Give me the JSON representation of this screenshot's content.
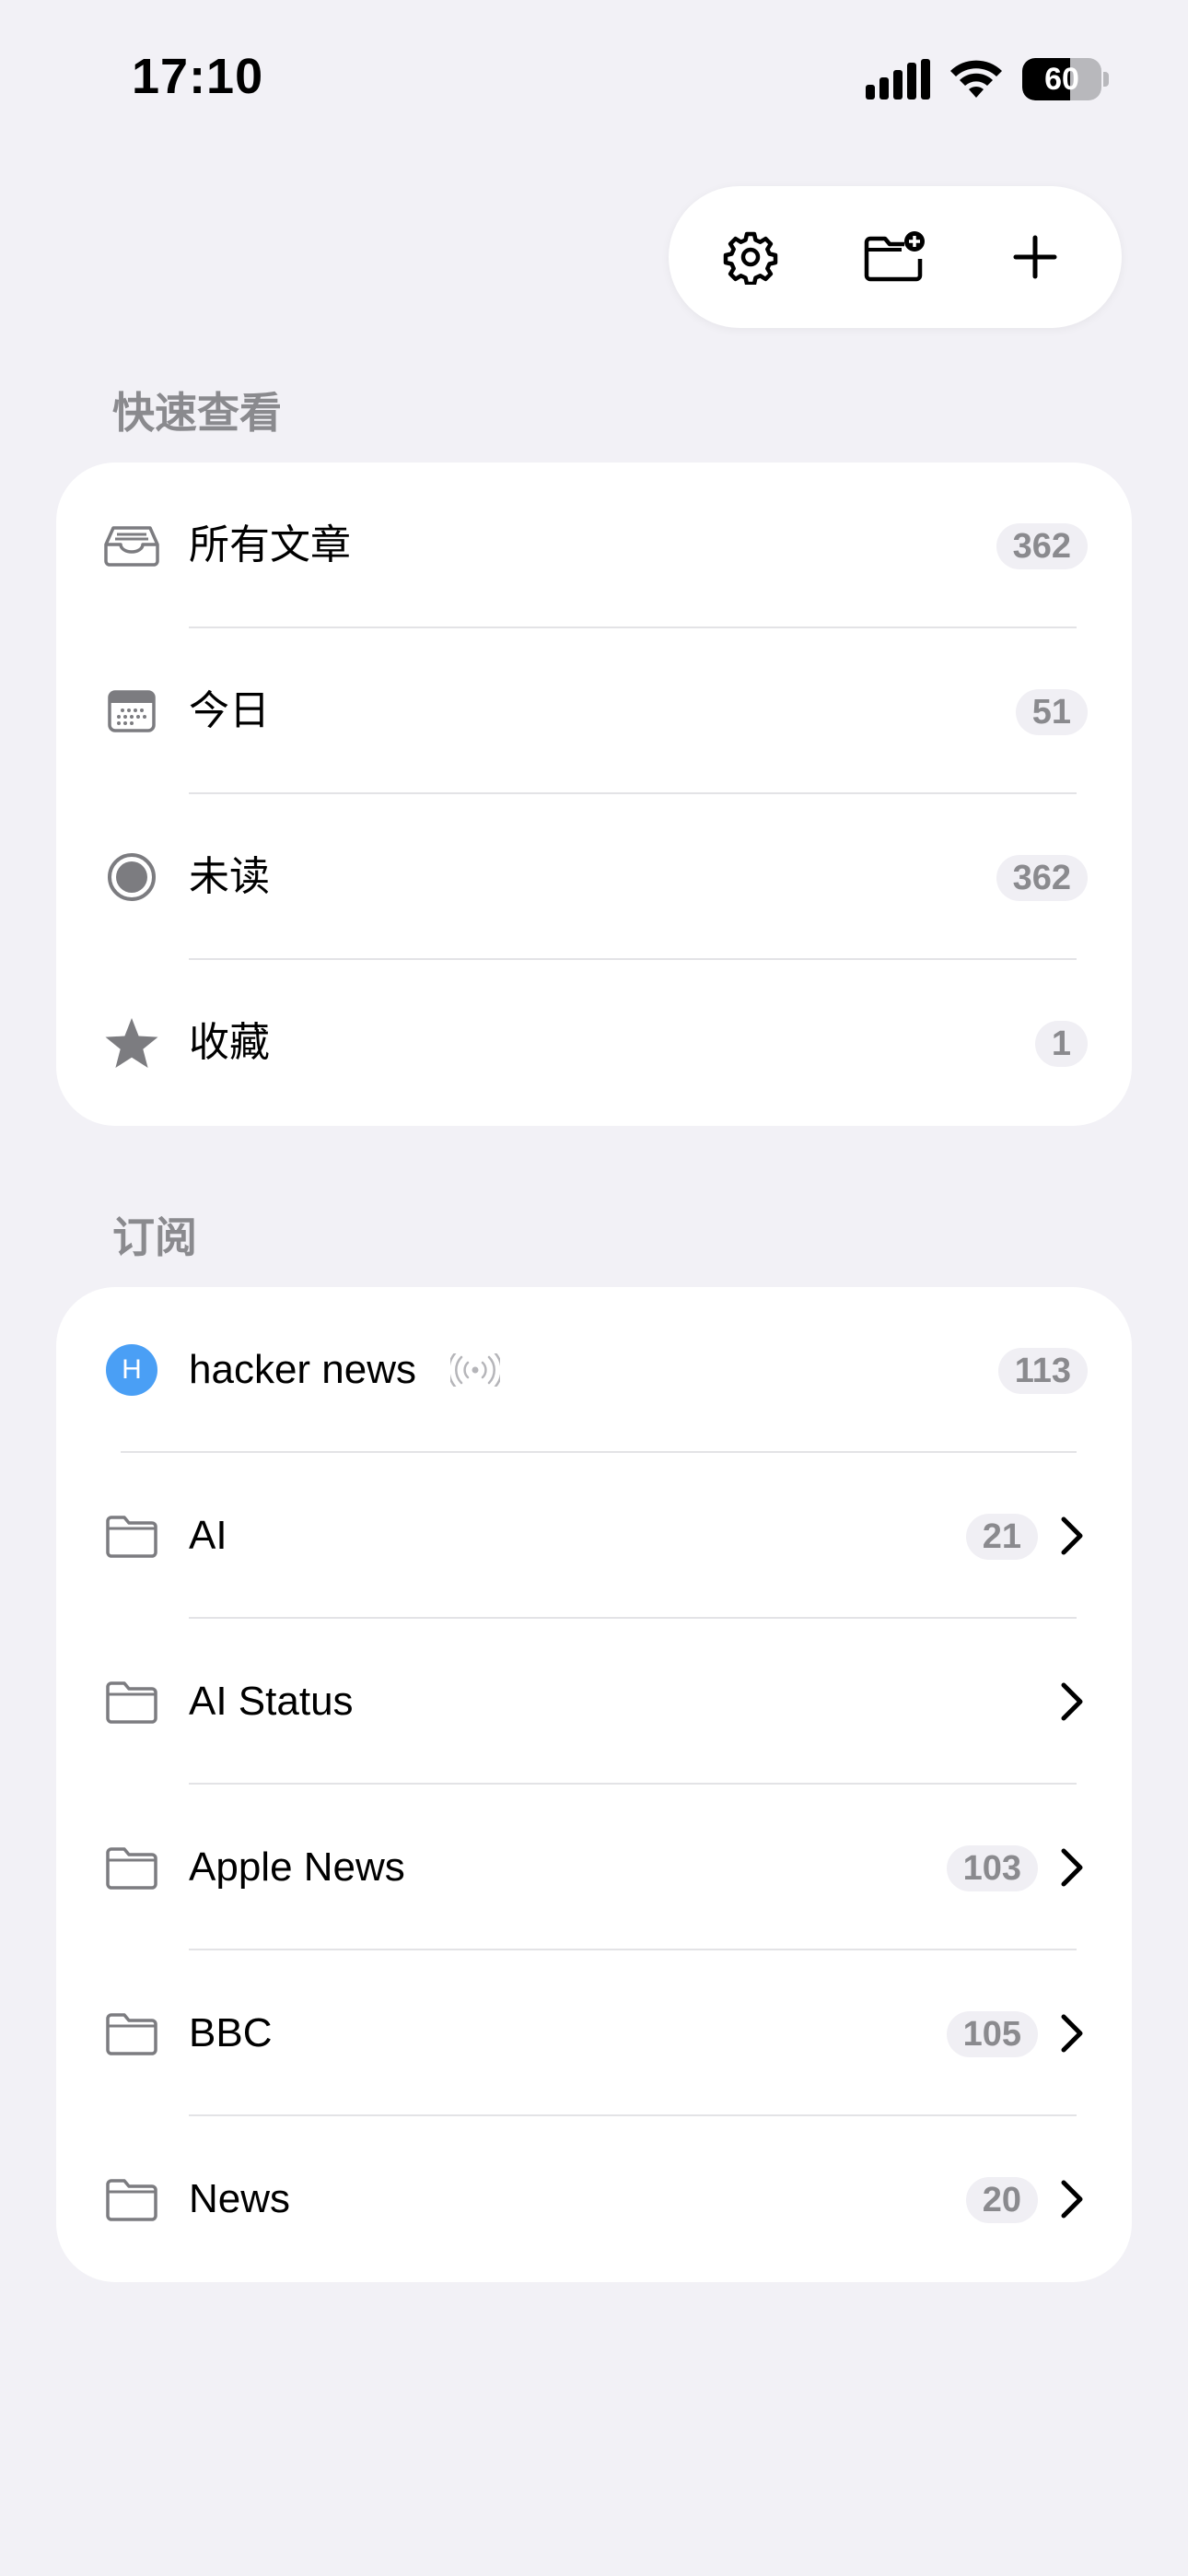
{
  "status_bar": {
    "time": "17:10",
    "battery": "60",
    "battery_level": 0.6
  },
  "toolbar": {
    "settings_icon": "gear-icon",
    "new_folder_icon": "folder-badge-plus-icon",
    "add_icon": "plus-icon"
  },
  "quick_view": {
    "header": "快速查看",
    "items": [
      {
        "label": "所有文章",
        "count": "362",
        "icon": "tray-icon"
      },
      {
        "label": "今日",
        "count": "51",
        "icon": "calendar-icon"
      },
      {
        "label": "未读",
        "count": "362",
        "icon": "unread-circle-icon"
      },
      {
        "label": "收藏",
        "count": "1",
        "icon": "star-icon"
      }
    ]
  },
  "subscriptions": {
    "header": "订阅",
    "feed": {
      "label": "hacker news",
      "avatar_letter": "H",
      "count": "113",
      "avatar_color": "#4a9ff5"
    },
    "folders": [
      {
        "label": "AI",
        "count": "21"
      },
      {
        "label": "AI Status",
        "count": ""
      },
      {
        "label": "Apple News",
        "count": "103"
      },
      {
        "label": "BBC",
        "count": "105"
      },
      {
        "label": "News",
        "count": "20"
      }
    ]
  }
}
